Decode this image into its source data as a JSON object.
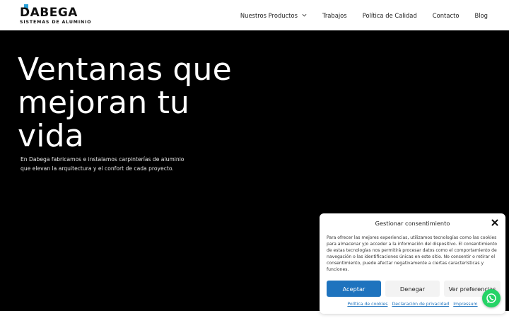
{
  "header": {
    "logo": {
      "word": "DABEGA",
      "subtitle": "SISTEMAS DE ALUMINIO",
      "accent_color": "#2aa0d8"
    },
    "nav": [
      {
        "label": "Nuestros Productos",
        "has_dropdown": true
      },
      {
        "label": "Trabajos"
      },
      {
        "label": "Política de Calidad"
      },
      {
        "label": "Contacto"
      },
      {
        "label": "Blog"
      }
    ]
  },
  "hero": {
    "title_lines": [
      "Ventanas que",
      "mejoran tu",
      "vida"
    ],
    "text_lines": [
      "En Dabega fabricamos e instalamos carpinterías de aluminio",
      "que elevan la arquitectura y el confort de cada proyecto."
    ],
    "background": "#000000"
  },
  "consent": {
    "title": "Gestionar consentimiento",
    "body": "Para ofrecer las mejores experiencias, utilizamos tecnologías como las cookies para almacenar y/o acceder a la información del dispositivo. El consentimiento de estas tecnologías nos permitirá procesar datos como el comportamiento de navegación o las identificaciones únicas en este sitio. No consentir o retirar el consentimiento, puede afectar negativamente a ciertas características y funciones.",
    "accept_label": "Aceptar",
    "deny_label": "Denegar",
    "prefs_label": "Ver preferencias",
    "links": [
      "Política de cookies",
      "Declaración de privacidad",
      "Impressum"
    ],
    "accent_color": "#1e73be"
  },
  "whatsapp": {
    "icon": "whatsapp-icon",
    "color": "#25d366"
  }
}
